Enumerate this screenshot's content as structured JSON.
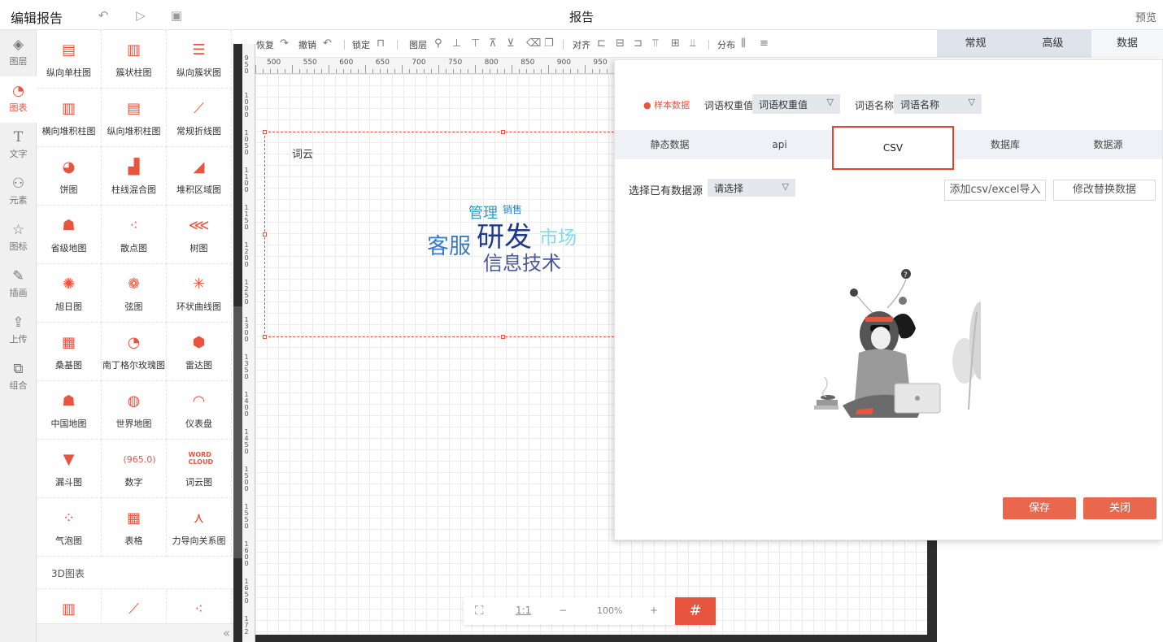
{
  "topbar": {
    "title": "编辑报告",
    "center_title": "报告",
    "preview": "预览"
  },
  "leftnav": {
    "items": [
      {
        "label": "图层",
        "icon": "layers-icon"
      },
      {
        "label": "图表",
        "icon": "chart-icon"
      },
      {
        "label": "文字",
        "icon": "text-icon"
      },
      {
        "label": "元素",
        "icon": "elements-icon"
      },
      {
        "label": "图标",
        "icon": "star-icon"
      },
      {
        "label": "插画",
        "icon": "palette-icon"
      },
      {
        "label": "上传",
        "icon": "upload-icon"
      },
      {
        "label": "组合",
        "icon": "group-icon"
      }
    ],
    "active": "图表"
  },
  "charts": {
    "items": [
      {
        "label": "纵向单柱图",
        "icon": "hbar-icon"
      },
      {
        "label": "簇状柱图",
        "icon": "cluster-bar-icon"
      },
      {
        "label": "纵向簇状图",
        "icon": "hcluster-icon"
      },
      {
        "label": "横向堆积柱图",
        "icon": "stacked-bar-icon"
      },
      {
        "label": "纵向堆积柱图",
        "icon": "hstacked-icon"
      },
      {
        "label": "常规折线图",
        "icon": "line-icon"
      },
      {
        "label": "饼图",
        "icon": "pie-icon"
      },
      {
        "label": "柱线混合图",
        "icon": "bar-line-icon"
      },
      {
        "label": "堆积区域图",
        "icon": "area-icon"
      },
      {
        "label": "省级地图",
        "icon": "province-map-icon"
      },
      {
        "label": "散点图",
        "icon": "scatter-icon"
      },
      {
        "label": "树图",
        "icon": "tree-icon"
      },
      {
        "label": "旭日图",
        "icon": "sunburst-icon"
      },
      {
        "label": "弦图",
        "icon": "chord-icon"
      },
      {
        "label": "环状曲线图",
        "icon": "ring-curve-icon"
      },
      {
        "label": "桑基图",
        "icon": "sankey-icon"
      },
      {
        "label": "南丁格尔玫瑰图",
        "icon": "rose-icon"
      },
      {
        "label": "雷达图",
        "icon": "radar-icon"
      },
      {
        "label": "中国地图",
        "icon": "china-map-icon"
      },
      {
        "label": "世界地图",
        "icon": "world-map-icon"
      },
      {
        "label": "仪表盘",
        "icon": "gauge-icon"
      },
      {
        "label": "漏斗图",
        "icon": "funnel-icon"
      },
      {
        "label": "数字",
        "icon": "number-icon"
      },
      {
        "label": "词云图",
        "icon": "wordcloud-icon"
      },
      {
        "label": "气泡图",
        "icon": "bubble-icon"
      },
      {
        "label": "表格",
        "icon": "table-icon"
      },
      {
        "label": "力导向关系图",
        "icon": "force-graph-icon"
      }
    ],
    "number_icon_text": "(965.0)",
    "wordcloud_icon_text": [
      "WORD",
      "CLOUD"
    ],
    "section_3d": "3D图表",
    "items_3d": [
      {
        "icon": "bar3d-icon"
      },
      {
        "icon": "line3d-icon"
      },
      {
        "icon": "scatter3d-icon"
      }
    ]
  },
  "toolbar": {
    "redo": "恢复",
    "undo": "撤销",
    "lock": "锁定",
    "layer": "图层",
    "align": "对齐",
    "distribute": "分布"
  },
  "ruler": {
    "h_ticks": [
      "500",
      "550",
      "600",
      "650",
      "700",
      "750",
      "800",
      "850",
      "900",
      "950"
    ],
    "v_ticks": [
      "950",
      "1000",
      "1050",
      "1100",
      "1150",
      "1200",
      "1250",
      "1300",
      "1350",
      "1400",
      "1450",
      "1500",
      "1550",
      "1600",
      "1650",
      "172"
    ]
  },
  "widget": {
    "title": "词云",
    "words": [
      {
        "text": "管理",
        "color": "#2a9fbf"
      },
      {
        "text": "销售",
        "color": "#2a7fc0"
      },
      {
        "text": "研发",
        "color": "#1f3a8a"
      },
      {
        "text": "市场",
        "color": "#7fdcf0"
      },
      {
        "text": "客服",
        "color": "#3a7bc8"
      },
      {
        "text": "信息技术",
        "color": "#4a5a9a"
      }
    ]
  },
  "zoombar": {
    "fit_icon": "fit-screen-icon",
    "ratio": "1:1",
    "minus": "−",
    "zoom": "100%",
    "plus": "+",
    "grid_icon": "grid-icon"
  },
  "rightpanel": {
    "tabs": [
      "常规",
      "高级",
      "数据"
    ],
    "active_tab": "数据"
  },
  "modal": {
    "sample_data": "样本数据",
    "weight_label": "词语权重值",
    "weight_value": "词语权重值",
    "name_label": "词语名称",
    "name_value": "词语名称",
    "tabs": [
      "静态数据",
      "api",
      "CSV",
      "数据库",
      "数据源"
    ],
    "active_tab": "CSV",
    "choose_label": "选择已有数据源",
    "choose_value": "请选择",
    "add_button": "添加csv/excel导入",
    "modify_button": "修改替换数据",
    "empty_illustration": "empty-state-illustration",
    "save": "保存",
    "close": "关闭",
    "accent": "#e8553f"
  }
}
